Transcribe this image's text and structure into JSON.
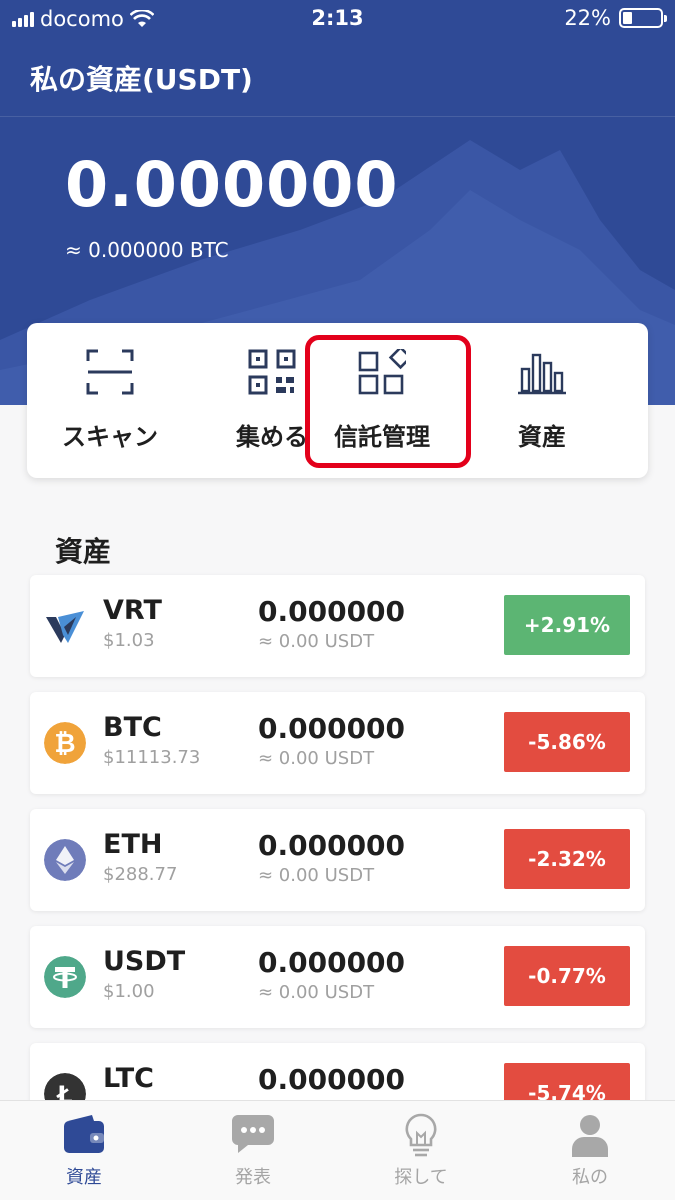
{
  "status_bar": {
    "carrier": "docomo",
    "time": "2:13",
    "battery": "22%"
  },
  "header": {
    "title": "私の資産(USDT)",
    "total_balance": "0.000000",
    "btc_equivalent": "≈ 0.000000 BTC"
  },
  "actions": [
    {
      "label": "スキャン",
      "icon": "scan-icon"
    },
    {
      "label": "集める",
      "icon": "qr-code-icon"
    },
    {
      "label": "信託管理",
      "icon": "apps-grid-icon"
    },
    {
      "label": "資産",
      "icon": "bar-chart-icon"
    }
  ],
  "assets_section": {
    "title": "資産",
    "rows": [
      {
        "symbol": "VRT",
        "price": "$1.03",
        "amount": "0.000000",
        "usdt_value": "≈ 0.00 USDT",
        "change": "+2.91%",
        "direction": "up"
      },
      {
        "symbol": "BTC",
        "price": "$11113.73",
        "amount": "0.000000",
        "usdt_value": "≈ 0.00 USDT",
        "change": "-5.86%",
        "direction": "down"
      },
      {
        "symbol": "ETH",
        "price": "$288.77",
        "amount": "0.000000",
        "usdt_value": "≈ 0.00 USDT",
        "change": "-2.32%",
        "direction": "down"
      },
      {
        "symbol": "USDT",
        "price": "$1.00",
        "amount": "0.000000",
        "usdt_value": "≈ 0.00 USDT",
        "change": "-0.77%",
        "direction": "down"
      },
      {
        "symbol": "LTC",
        "price": "",
        "amount": "0.000000",
        "usdt_value": "",
        "change": "-5.74%",
        "direction": "down"
      }
    ]
  },
  "bottom_nav": [
    {
      "label": "資産",
      "icon": "wallet-icon",
      "active": true
    },
    {
      "label": "発表",
      "icon": "chat-bubble-icon",
      "active": false
    },
    {
      "label": "探して",
      "icon": "lightbulb-icon",
      "active": false
    },
    {
      "label": "私の",
      "icon": "person-icon",
      "active": false
    }
  ],
  "colors": {
    "primary": "#2f4a96",
    "up": "#5cb573",
    "down": "#e34c40",
    "highlight": "#e3001b"
  }
}
